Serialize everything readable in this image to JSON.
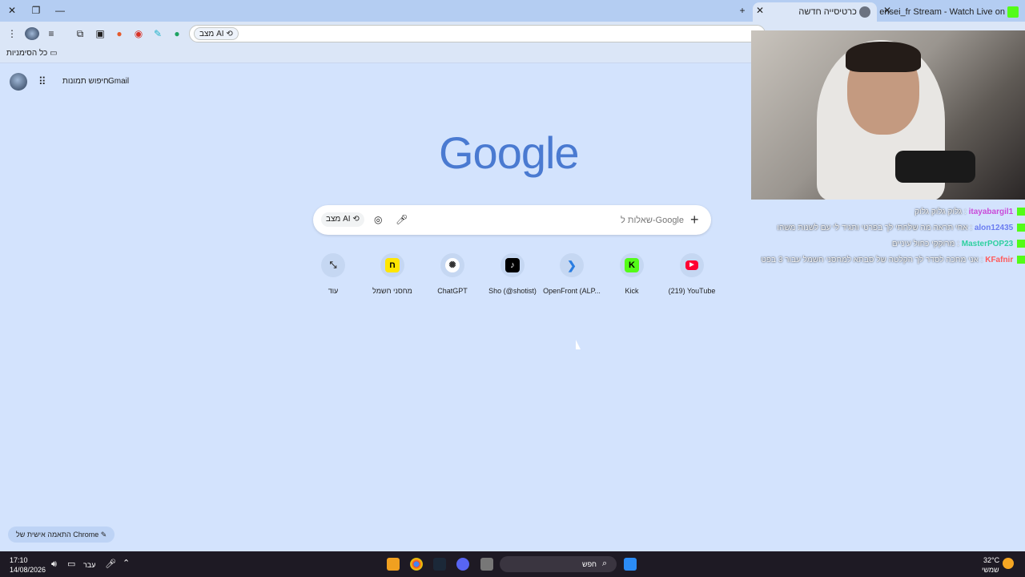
{
  "tabs": [
    {
      "label": "כרטיסייה חדשה",
      "active": true
    },
    {
      "label": "sensei_fr Stream - Watch Live on",
      "active": false
    }
  ],
  "toolbar": {
    "ai_mode_label": "מצב AI"
  },
  "bookmarks": {
    "all_bookmarks_label": "כל הסימניות"
  },
  "page": {
    "gmail_label": "Gmail",
    "images_label": "חיפוש תמונות",
    "logo_text": "Google",
    "search_placeholder": "שאלות ל-Google",
    "ai_mode_label": "מצב AI",
    "customize_label": "התאמה אישית של Chrome"
  },
  "shortcuts": [
    {
      "label": "(219) YouTube",
      "icon": "youtube-icon",
      "color": "#ff0033"
    },
    {
      "label": "Kick",
      "icon": "kick-icon",
      "color": "#53fc18"
    },
    {
      "label": "OpenFront (ALP...",
      "icon": "openfront-icon",
      "color": "#2a7de1"
    },
    {
      "label": "Sho (@shotist)",
      "icon": "tiktok-icon",
      "color": "#000000"
    },
    {
      "label": "ChatGPT",
      "icon": "chatgpt-icon",
      "color": "#ffffff"
    },
    {
      "label": "מחסני חשמל",
      "icon": "store-icon",
      "color": "#ffe600"
    },
    {
      "label": "עוד",
      "icon": "expand-icon",
      "color": "#c5d7f2"
    }
  ],
  "chat": [
    {
      "user": "itayabargil1",
      "msg": "גלוק גלוק גלוק",
      "color": "#c94ad8"
    },
    {
      "user": "alon12435",
      "msg": "אחי תראה מה שלחתי לך בפרטי ותגיד לי עם לשנות משהו",
      "color": "#6b7df0"
    },
    {
      "user": "MasterPOP23",
      "msg": "מרוקקי כחול עיניים",
      "color": "#2fd0a0"
    },
    {
      "user": "KFafnir",
      "msg": "אני מחכה לסדר לך הקלטה של סבתא למחסני חשמל עבור 3 בפטיים",
      "color": "#ff5a5a"
    }
  ],
  "taskbar": {
    "time": "17:10",
    "date": "14/08/2026",
    "lang": "עבר",
    "search_label": "חפש",
    "temperature": "32°C",
    "weather_label": "שמשי"
  }
}
